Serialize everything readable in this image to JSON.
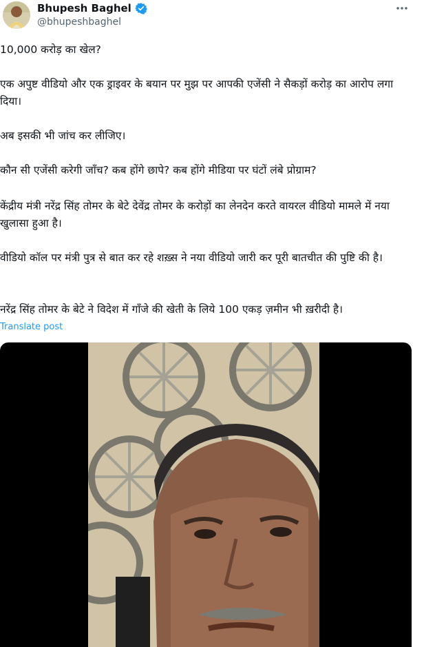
{
  "author": {
    "name": "Bhupesh Baghel",
    "handle": "@bhupeshbaghel",
    "verified_icon": "verified-badge-icon",
    "more_icon": "more-options-icon"
  },
  "tweet": {
    "paragraphs": [
      "10,000 करोड़ का खेल?",
      "एक अपुष्ट वीडियो और एक ड्राइवर के बयान पर मुझ पर आपकी एजेंसी ने सैकड़ों करोड़ का आरोप लगा दिया।",
      "अब इसकी भी जांच कर लीजिए।",
      "कौन सी एजेंसी करेगी जाँच? कब होंगे छापे? कब होंगे मीडिया पर घंटों लंबे प्रोग्राम?",
      "केंद्रीय मंत्री नरेंद्र सिंह तोमर के बेटे देवेंद्र तोमर के करोड़ों का लेनदेन करते वायरल वीडियो मामले में नया खुलासा हुआ है।",
      "वीडियो कॉल पर मंत्री पुत्र से बात कर रहे शख़्स ने नया वीडियो जारी कर पूरी बातचीत की पुष्टि की है।",
      "नरेंद्र सिंह तोमर के बेटे ने विदेश में गाँजे की खेती के लिये 100 एकड़ ज़मीन भी ख़रीदी है।"
    ],
    "translate_label": "Translate post"
  },
  "colors": {
    "accent": "#1d9bf0",
    "text": "#0f1419",
    "secondary": "#536471"
  }
}
